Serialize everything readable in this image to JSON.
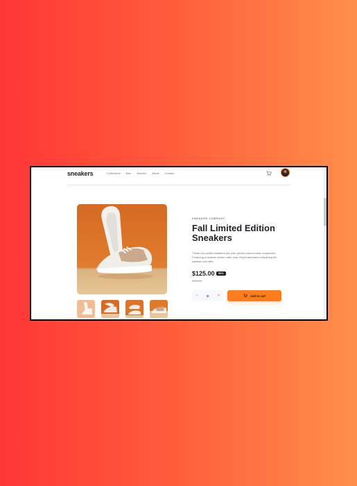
{
  "brand": "sneakers",
  "nav": {
    "links": [
      "Collections",
      "Men",
      "Women",
      "About",
      "Contact"
    ]
  },
  "header": {
    "cart_icon": "cart-icon",
    "avatar": "user-avatar"
  },
  "product": {
    "company": "SNEAKER COMPANY",
    "title": "Fall Limited Edition Sneakers",
    "description": "These low-profile sneakers are your perfect casual wear companion. Featuring a durable rubber outer sole, they'll withstand everything the weather can offer.",
    "price": "$125.00",
    "discount": "50%",
    "original_price": "$250.00"
  },
  "cart": {
    "minus": "−",
    "quantity": "0",
    "plus": "+",
    "add_label": "Add to cart"
  },
  "colors": {
    "accent": "#ff7e1b",
    "dark": "#1d2025",
    "muted": "#69707d"
  }
}
